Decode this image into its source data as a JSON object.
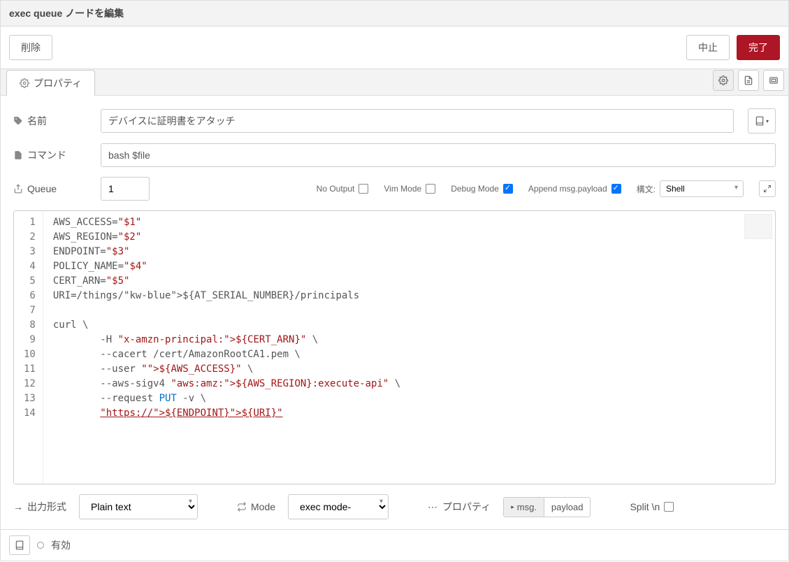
{
  "header": {
    "title": "exec queue ノードを編集"
  },
  "toolbar": {
    "delete": "削除",
    "cancel": "中止",
    "done": "完了"
  },
  "tabs": {
    "properties": "プロパティ"
  },
  "form": {
    "name_label": "名前",
    "name_value": "デバイスに証明書をアタッチ",
    "command_label": "コマンド",
    "command_value": "bash $file",
    "queue_label": "Queue",
    "queue_value": "1",
    "opts": {
      "no_output": "No Output",
      "vim_mode": "Vim Mode",
      "debug_mode": "Debug Mode",
      "append_payload": "Append msg.payload",
      "syntax_label": "構文:",
      "syntax_value": "Shell"
    }
  },
  "editor": {
    "lines": [
      "1",
      "2",
      "3",
      "4",
      "5",
      "6",
      "7",
      "8",
      "9",
      "10",
      "11",
      "12",
      "13",
      "14"
    ]
  },
  "chart_data": {
    "type": "code",
    "language": "shell",
    "content": "AWS_ACCESS=\"$1\"\nAWS_REGION=\"$2\"\nENDPOINT=\"$3\"\nPOLICY_NAME=\"$4\"\nCERT_ARN=\"$5\"\nURI=/things/${AT_SERIAL_NUMBER}/principals\n\ncurl \\\n        -H \"x-amzn-principal:${CERT_ARN}\" \\\n        --cacert /cert/AmazonRootCA1.pem \\\n        --user \"${AWS_ACCESS}\" \\\n        --aws-sigv4 \"aws:amz:${AWS_REGION}:execute-api\" \\\n        --request PUT -v \\\n        \"https://${ENDPOINT}${URI}\""
  },
  "output": {
    "format_label": "出力形式",
    "format_value": "Plain text",
    "mode_label": "Mode",
    "mode_value": "exec mode-",
    "prop_label": "プロパティ",
    "prop_prefix": "msg.",
    "prop_value": "payload",
    "split_label": "Split \\n"
  },
  "footer": {
    "enabled_label": "有効"
  }
}
